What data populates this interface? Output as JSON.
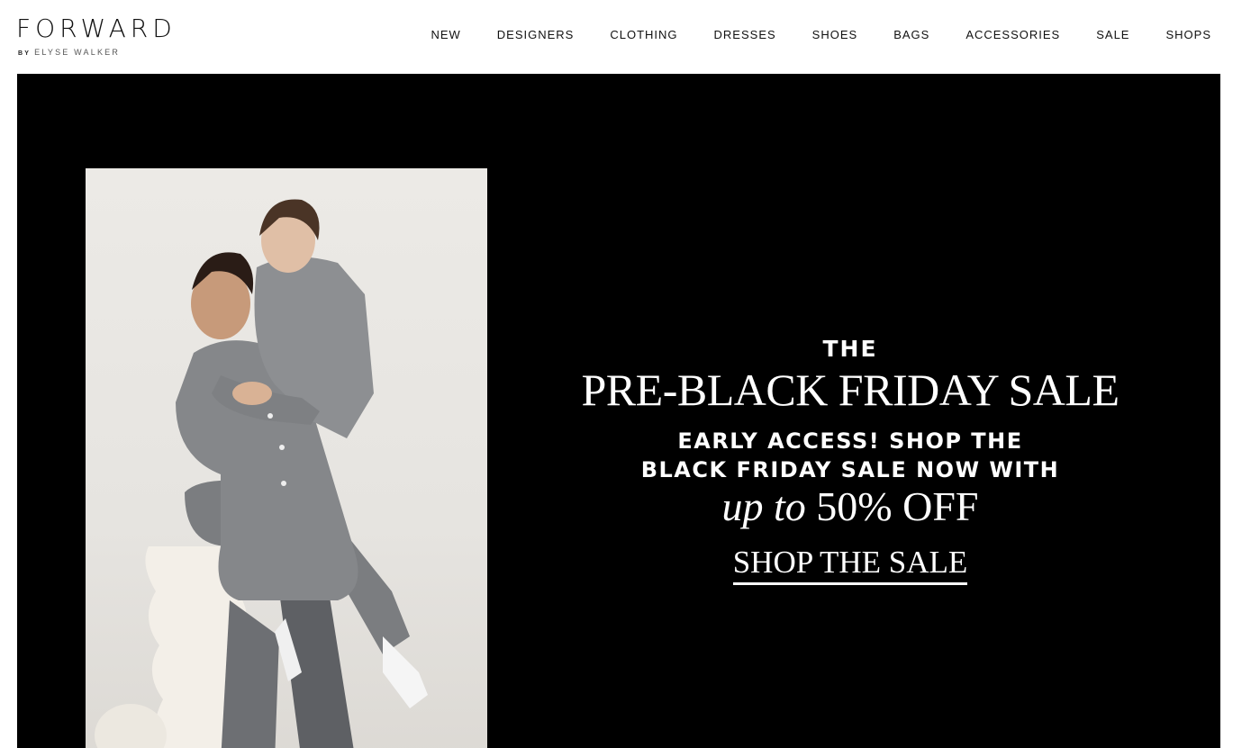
{
  "header": {
    "logo": {
      "main": "FORWARD",
      "by": "BY",
      "sub": "ELYSE WALKER"
    },
    "nav": [
      {
        "label": "NEW"
      },
      {
        "label": "DESIGNERS"
      },
      {
        "label": "CLOTHING"
      },
      {
        "label": "DRESSES"
      },
      {
        "label": "SHOES"
      },
      {
        "label": "BAGS"
      },
      {
        "label": "ACCESSORIES"
      },
      {
        "label": "SALE"
      },
      {
        "label": "SHOPS"
      }
    ]
  },
  "hero": {
    "background_color": "#000000",
    "pre_title": "THE",
    "title": "PRE-BLACK FRIDAY SALE",
    "subtitle_line1": "EARLY ACCESS! SHOP THE",
    "subtitle_line2": "BLACK FRIDAY SALE NOW WITH",
    "offer_italic": "up to",
    "offer_value": "50% OFF",
    "cta_label": "SHOP THE SALE"
  }
}
